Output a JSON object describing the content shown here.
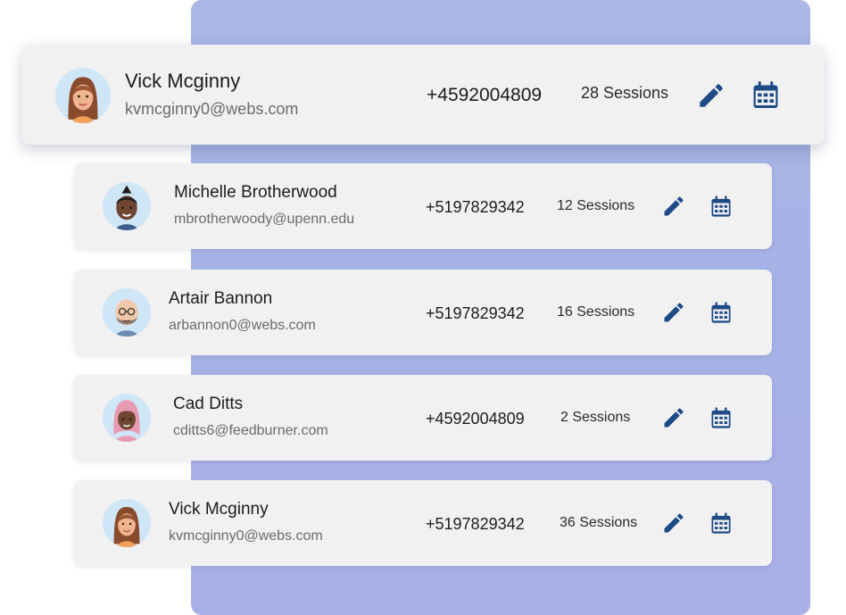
{
  "colors": {
    "backdrop": "#a9b3e6",
    "card": "#f1f1f2",
    "icon": "#1e4a86",
    "avatar_bg": "#cfe6f7"
  },
  "featured": {
    "name": "Vick Mcginny",
    "email": "kvmcginny0@webs.com",
    "phone": "+4592004809",
    "sessions": "28 Sessions",
    "avatar": "woman-auburn-hair-avatar"
  },
  "rows": [
    {
      "name": "Michelle Brotherwood",
      "email": "mbrotherwoody@upenn.edu",
      "phone": "+5197829342",
      "sessions": "12 Sessions",
      "avatar": "man-mohawk-avatar"
    },
    {
      "name": "Artair Bannon",
      "email": "arbannon0@webs.com",
      "phone": "+5197829342",
      "sessions": "16 Sessions",
      "avatar": "bald-man-glasses-avatar"
    },
    {
      "name": "Cad Ditts",
      "email": "cditts6@feedburner.com",
      "phone": "+4592004809",
      "sessions": "2 Sessions",
      "avatar": "woman-headscarf-avatar"
    },
    {
      "name": "Vick Mcginny",
      "email": "kvmcginny0@webs.com",
      "phone": "+5197829342",
      "sessions": "36 Sessions",
      "avatar": "woman-auburn-hair-avatar"
    }
  ]
}
